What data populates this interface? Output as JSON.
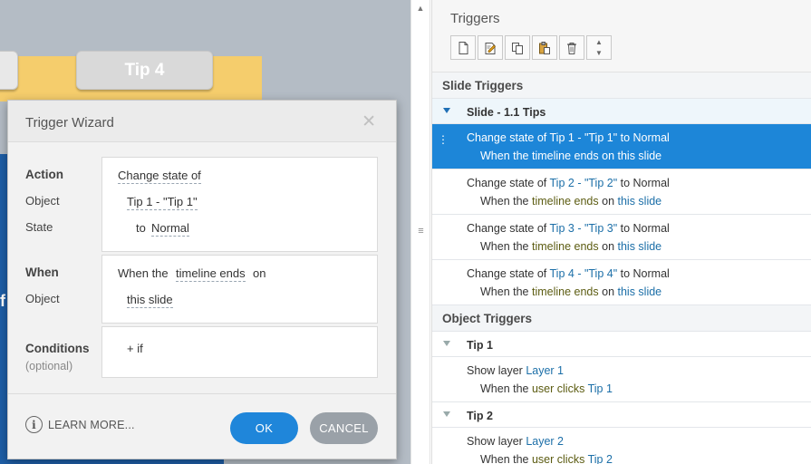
{
  "canvas": {
    "tab_label": "Tip 4",
    "blue_fragment": "f"
  },
  "dialog": {
    "title": "Trigger Wizard",
    "close_icon": "close-icon",
    "labels": {
      "action": "Action",
      "object": "Object",
      "state": "State",
      "when": "When",
      "when_object": "Object",
      "conditions": "Conditions",
      "optional": "(optional)"
    },
    "action_value": "Change state of",
    "object_value": "Tip 1 - \"Tip 1\"",
    "state_prefix": "to",
    "state_value": "Normal",
    "when_prefix": "When the",
    "when_value": "timeline ends",
    "when_suffix": "on",
    "when_object_value": "this slide",
    "conditions_value": "+ if",
    "learn_more": "LEARN MORE...",
    "ok": "OK",
    "cancel": "CANCEL"
  },
  "panel": {
    "title": "Triggers",
    "tools": [
      "new-trigger-icon",
      "edit-trigger-icon",
      "copy-icon",
      "paste-icon",
      "delete-icon",
      "move-up-down-icon"
    ],
    "slide_section": "Slide Triggers",
    "slide_group": "Slide - 1.1 Tips",
    "slide_triggers": [
      {
        "pre": "Change state of ",
        "obj": "Tip 1 - \"Tip 1\"",
        "mid": " to ",
        "state": "Normal",
        "w1": "When the ",
        "event": "timeline ends",
        "w2": " on ",
        "target": "this slide"
      },
      {
        "pre": "Change state of ",
        "obj": "Tip 2 - \"Tip 2\"",
        "mid": " to ",
        "state": "Normal",
        "w1": "When the ",
        "event": "timeline ends",
        "w2": " on ",
        "target": "this slide"
      },
      {
        "pre": "Change state of ",
        "obj": "Tip 3 - \"Tip 3\"",
        "mid": " to ",
        "state": "Normal",
        "w1": "When the ",
        "event": "timeline ends",
        "w2": " on ",
        "target": "this slide"
      },
      {
        "pre": "Change state of ",
        "obj": "Tip 4 - \"Tip 4\"",
        "mid": " to ",
        "state": "Normal",
        "w1": "When the ",
        "event": "timeline ends",
        "w2": " on ",
        "target": "this slide"
      }
    ],
    "object_section": "Object Triggers",
    "object_groups": [
      {
        "name": "Tip 1",
        "pre": "Show layer ",
        "layer": "Layer 1",
        "w1": "When the ",
        "event": "user clicks",
        "w2": " ",
        "target": "Tip 1"
      },
      {
        "name": "Tip 2",
        "pre": "Show layer ",
        "layer": "Layer 2",
        "w1": "When the ",
        "event": "user clicks",
        "w2": " ",
        "target": "Tip 2"
      }
    ]
  }
}
